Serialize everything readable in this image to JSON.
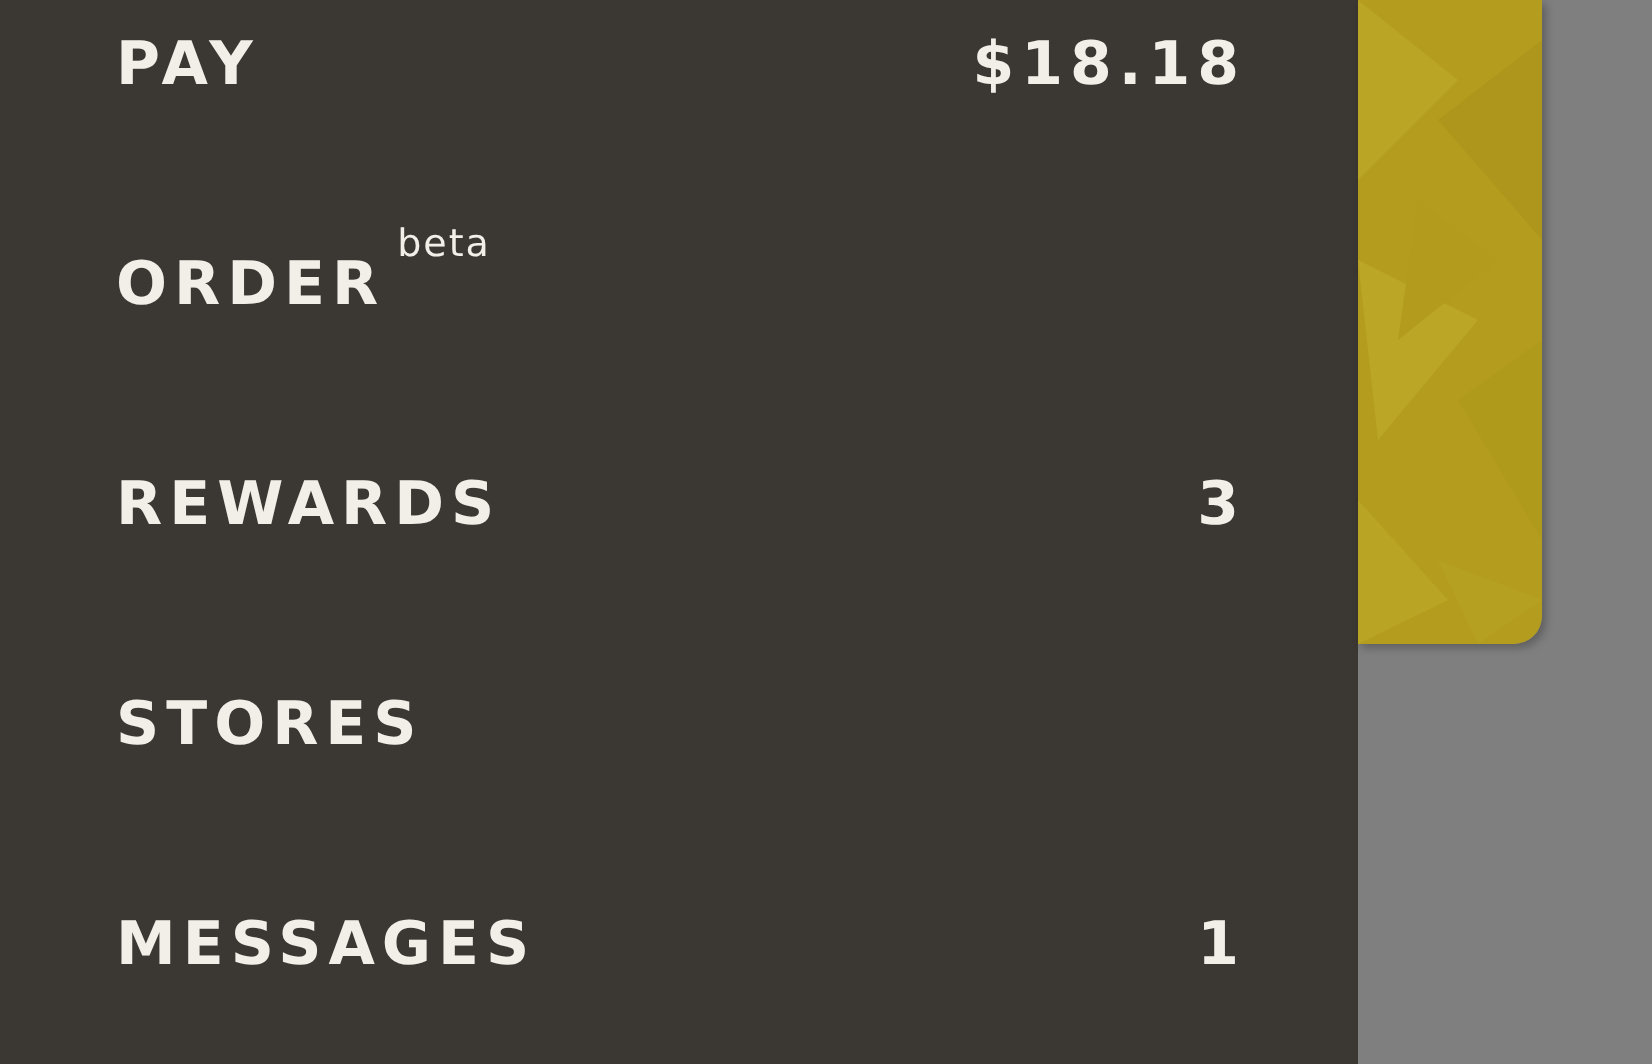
{
  "menu": [
    {
      "label": "PAY",
      "value": "$18.18"
    },
    {
      "label": "ORDER",
      "badge": "beta"
    },
    {
      "label": "REWARDS",
      "value": "3"
    },
    {
      "label": "STORES"
    },
    {
      "label": "MESSAGES",
      "value": "1"
    }
  ]
}
